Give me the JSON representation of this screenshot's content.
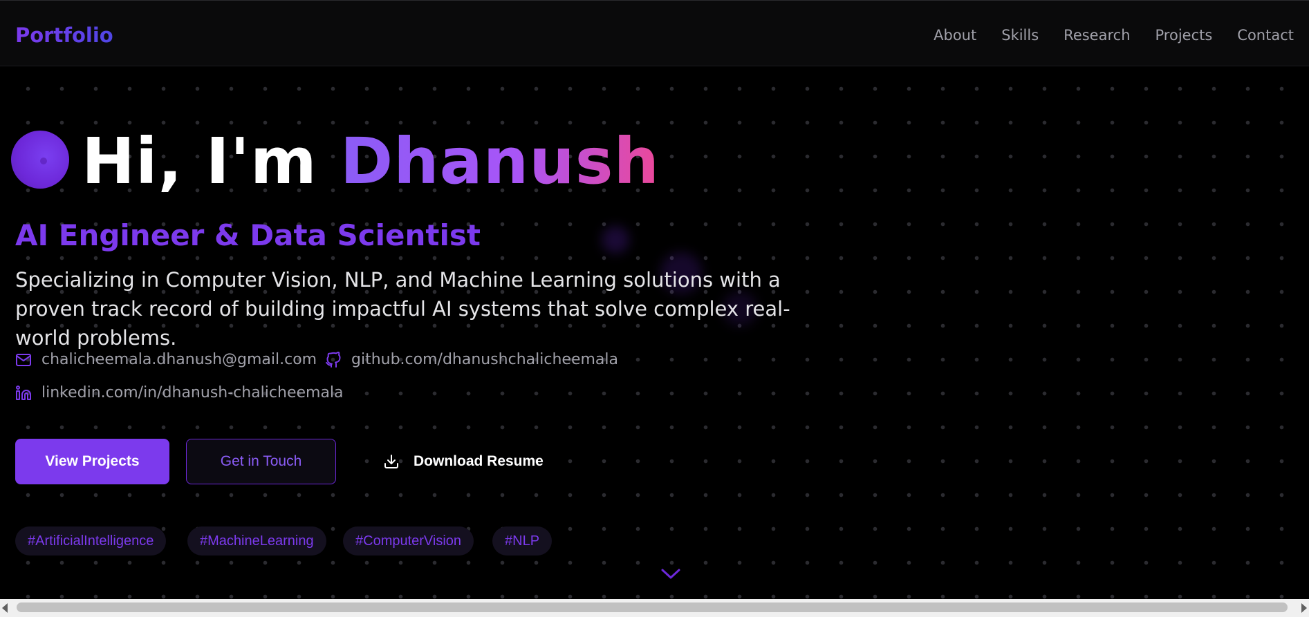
{
  "nav": {
    "brand": "Portfolio",
    "links": [
      "About",
      "Skills",
      "Research",
      "Projects",
      "Contact"
    ]
  },
  "hero": {
    "greeting": "Hi, I'm ",
    "name": "Dhanush",
    "subtitle": "AI Engineer & Data Scientist",
    "tagline": "Specializing in Computer Vision, NLP, and Machine Learning solutions with a proven track record of building impactful AI systems that solve complex real-world problems.",
    "contacts": {
      "email": "chalicheemala.dhanush@gmail.com",
      "github": "github.com/dhanushchalicheemala",
      "linkedin": "linkedin.com/in/dhanush-chalicheemala"
    },
    "buttons": {
      "primary": "View Projects",
      "secondary": "Get in Touch",
      "download": "Download Resume"
    },
    "tags": [
      "#ArtificialIntelligence",
      "#MachineLearning",
      "#ComputerVision",
      "#NLP"
    ]
  },
  "icons": [
    "mail-icon",
    "github-icon",
    "linkedin-icon",
    "download-icon",
    "chevron-down-icon"
  ],
  "colors": {
    "accent": "#7c3aed",
    "gradient_start": "#8b5cf6",
    "gradient_end": "#ec4899",
    "background": "#000000"
  }
}
